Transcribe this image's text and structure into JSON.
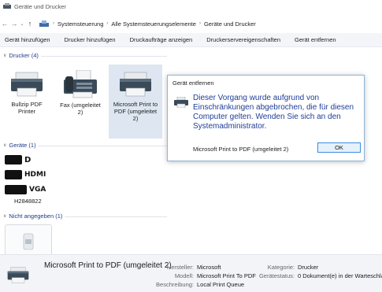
{
  "window": {
    "title": "Geräte und Drucker"
  },
  "address": {
    "crumbs": [
      "Systemsteuerung",
      "Alle Systemsteuerungselemente",
      "Geräte und Drucker"
    ]
  },
  "commands": [
    "Gerät hinzufügen",
    "Drucker hinzufügen",
    "Druckaufträge anzeigen",
    "Druckerservereigenschaften",
    "Gerät entfernen"
  ],
  "groups": {
    "printers": {
      "header": "Drucker (4)",
      "items": [
        {
          "line1": "Bullzip PDF",
          "line2": "Printer",
          "line3": ""
        },
        {
          "line1": "Fax (umgeleitet",
          "line2": "2)",
          "line3": ""
        },
        {
          "line1": "Microsoft Print to",
          "line2": "PDF (umgeleitet",
          "line3": "2)"
        }
      ]
    },
    "devices": {
      "header": "Geräte (1)",
      "hw_labels": [
        "D",
        "HDMI",
        "VGA"
      ],
      "device_label": "H2848822"
    },
    "unspecified": {
      "header": "Nicht angegeben (1)"
    }
  },
  "dialog": {
    "title": "Gerät entfernen",
    "message": "Dieser Vorgang wurde aufgrund von Einschränkungen abgebrochen, die für diesen Computer gelten. Wenden Sie sich an den Systemadministrator.",
    "subject": "Microsoft Print to PDF (umgeleitet 2)",
    "ok_label": "OK"
  },
  "details": {
    "name": "Microsoft Print to PDF (umgeleitet 2)",
    "manufacturer_label": "Hersteller:",
    "manufacturer": "Microsoft",
    "model_label": "Modell:",
    "model": "Microsoft Print To PDF",
    "description_label": "Beschreibung:",
    "description": "Local Print Queue",
    "category_label": "Kategorie:",
    "category": "Drucker",
    "status_label": "Gerätestatus:",
    "status": "0 Dokument(e) in der Warteschla"
  }
}
